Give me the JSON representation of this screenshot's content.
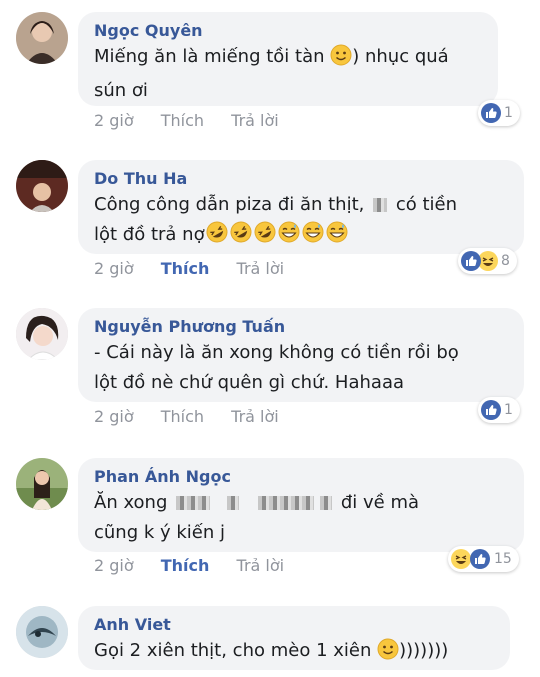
{
  "comments": [
    {
      "author": "Ngọc Quyên",
      "line1_a": "Miếng ăn là miếng tồi tàn ",
      "line1_b": ") nhục quá",
      "line2": "sún ơi",
      "time": "2 giờ",
      "like": "Thích",
      "reply": "Trả lời",
      "reaction_count": "1",
      "emoji": [
        "slightly-smiling-face"
      ]
    },
    {
      "author": "Do Thu Ha",
      "line1_a": "Công công dẫn piza đi ăn thịt, ",
      "line1_b": " có tiền",
      "line2": "lột đồ trả nợ",
      "time": "2 giờ",
      "like": "Thích",
      "reply": "Trả lời",
      "reaction_count": "8",
      "emoji": [
        "rofl-face",
        "rofl-face",
        "rofl-face",
        "grinning-sweat-face",
        "grinning-sweat-face",
        "grinning-sweat-face"
      ]
    },
    {
      "author": "Nguyễn Phương Tuấn",
      "line1": "- Cái này là ăn xong không có tiền rồi bọ",
      "line2": "lột đồ nè chứ quên gì chứ. Hahaaa",
      "time": "2 giờ",
      "like": "Thích",
      "reply": "Trả lời",
      "reaction_count": "1"
    },
    {
      "author": "Phan Ánh Ngọc",
      "line1_a": "Ăn xong ",
      "line1_b": " đi về mà",
      "line2": "cũng k ý kiến j",
      "time": "2 giờ",
      "like": "Thích",
      "reply": "Trả lời",
      "reaction_count": "15"
    },
    {
      "author": "Anh Viet",
      "line1_a": "Gọi 2 xiên thịt, cho mèo 1 xiên ",
      "line1_b": ")))))))",
      "emoji": [
        "slightly-smiling-face"
      ]
    }
  ],
  "colors": {
    "name": "#385898",
    "bubble": "#f2f3f5",
    "meta": "#90949c",
    "liked": "#4267b2",
    "like_reaction": "#4267b2",
    "haha_reaction": "#fcd65b"
  }
}
